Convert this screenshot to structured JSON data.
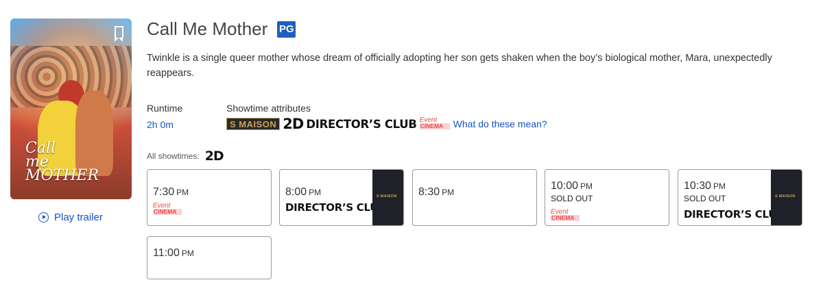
{
  "movie": {
    "title": "Call Me Mother",
    "rating": "PG",
    "poster_title": "Call me MOTHER",
    "synopsis": "Twinkle is a single queer mother whose dream of officially adopting her son gets shaken when the boy’s biological mother, Mara, unexpectedly reappears.",
    "play_trailer_label": "Play trailer"
  },
  "details": {
    "runtime_label": "Runtime",
    "runtime_value": "2h 0m",
    "attributes_label": "Showtime attributes",
    "attributes": [
      "S MAISON",
      "2D",
      "DIRECTOR’S CLUB",
      "Event CINEMA"
    ],
    "what_link": "What do these mean?"
  },
  "showtimes_header": {
    "label": "All showtimes:",
    "format": "2D"
  },
  "showtimes": [
    {
      "time": "7:30",
      "period": "PM",
      "sold_out": "",
      "event_logo": "Event CINEMA",
      "club": "",
      "side_logo": ""
    },
    {
      "time": "8:00",
      "period": "PM",
      "sold_out": "",
      "event_logo": "",
      "club": "DIRECTOR’S CLUB",
      "side_logo": "S MAISON"
    },
    {
      "time": "8:30",
      "period": "PM",
      "sold_out": "",
      "event_logo": "",
      "club": "",
      "side_logo": ""
    },
    {
      "time": "10:00",
      "period": "PM",
      "sold_out": "SOLD OUT",
      "event_logo": "Event CINEMA",
      "club": "",
      "side_logo": ""
    },
    {
      "time": "10:30",
      "period": "PM",
      "sold_out": "SOLD OUT",
      "event_logo": "",
      "club": "DIRECTOR’S CLUB",
      "side_logo": "S MAISON"
    },
    {
      "time": "11:00",
      "period": "PM",
      "sold_out": "",
      "event_logo": "",
      "club": "",
      "side_logo": ""
    }
  ],
  "colors": {
    "link": "#1552c7",
    "rating_badge": "#1f5fbf",
    "event_cinema": "#e84a4a",
    "smaison_gold": "#c8a15a",
    "smaison_dark": "#1f2128"
  }
}
